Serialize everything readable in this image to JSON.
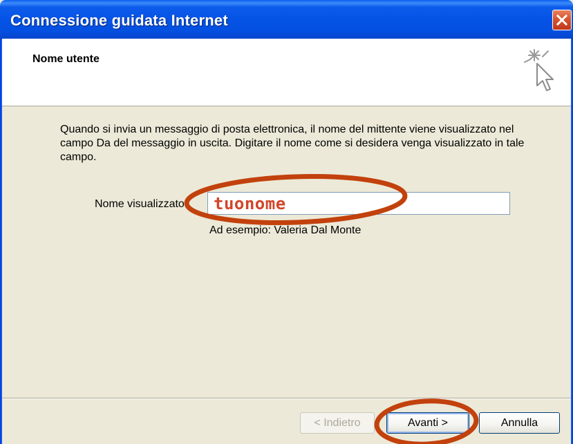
{
  "window": {
    "title": "Connessione guidata Internet"
  },
  "header": {
    "title": "Nome utente",
    "icon": "wizard-sparkle-cursor-icon"
  },
  "body": {
    "description": "Quando si invia un messaggio di posta elettronica, il nome del mittente viene visualizzato nel campo Da del messaggio in uscita. Digitare il nome come si desidera venga visualizzato in tale campo."
  },
  "form": {
    "display_name_label": "Nome visualizzato:",
    "display_name_value": "tuonome",
    "example_text": "Ad esempio: Valeria Dal Monte"
  },
  "buttons": {
    "back_label": "< Indietro",
    "next_label": "Avanti >",
    "cancel_label": "Annulla"
  },
  "colors": {
    "titlebar": "#0553E6",
    "annotation": "#C2410C",
    "input_text": "#D2452A"
  }
}
